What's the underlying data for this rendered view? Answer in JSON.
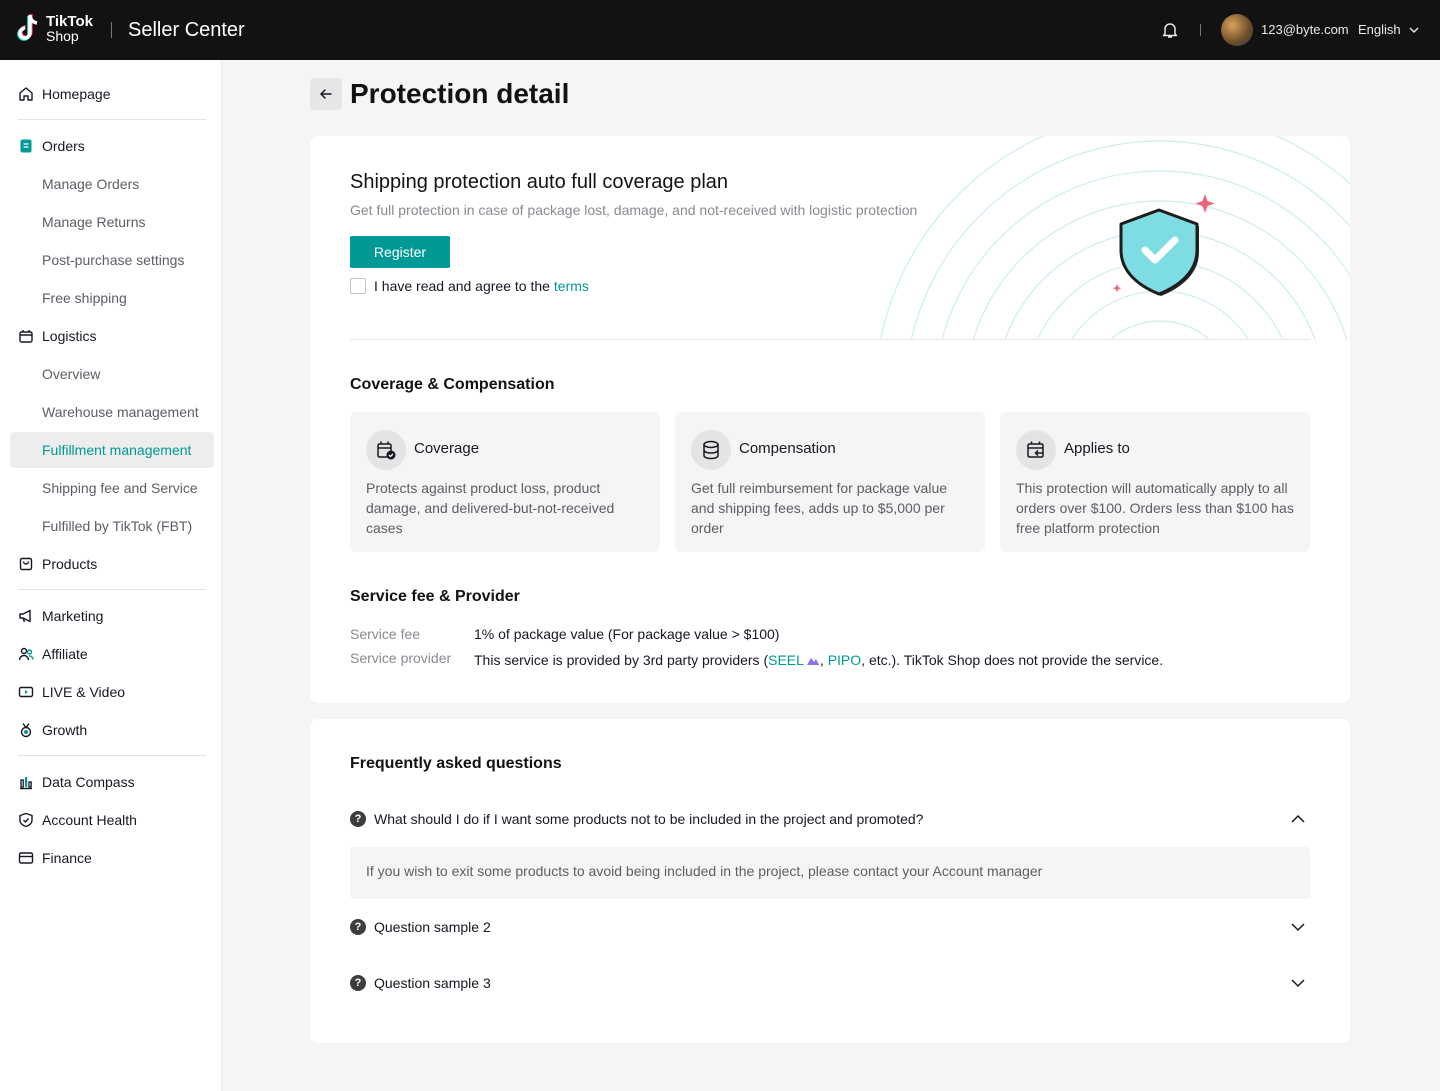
{
  "header": {
    "logo_line1": "TikTok",
    "logo_line2": "Shop",
    "app_name": "Seller Center",
    "user_email": "123@byte.com",
    "language": "English"
  },
  "sidebar": {
    "homepage": "Homepage",
    "orders": "Orders",
    "manage_orders": "Manage Orders",
    "manage_returns": "Manage Returns",
    "post_purchase": "Post-purchase settings",
    "free_shipping": "Free shipping",
    "logistics": "Logistics",
    "overview": "Overview",
    "warehouse": "Warehouse management",
    "fulfillment": "Fulfillment management",
    "shipping_fee": "Shipping fee and Service",
    "fbt": "Fulfilled by TikTok (FBT)",
    "products": "Products",
    "marketing": "Marketing",
    "affiliate": "Affiliate",
    "live_video": "LIVE & Video",
    "growth": "Growth",
    "data_compass": "Data Compass",
    "account_health": "Account Health",
    "finance": "Finance"
  },
  "page": {
    "title": "Protection detail"
  },
  "plan": {
    "title": "Shipping protection auto full coverage plan",
    "subtitle": "Get full protection in case of package lost, damage, and not-received with logistic protection",
    "register_label": "Register",
    "agree_text": "I have read and agree to the",
    "terms_label": "terms"
  },
  "coverage": {
    "section_title": "Coverage & Compensation",
    "features": [
      {
        "title": "Coverage",
        "desc": "Protects against product loss, product damage, and delivered-but-not-received cases",
        "icon": "package-shield-icon"
      },
      {
        "title": "Compensation",
        "desc": "Get full reimbursement for package value and shipping fees, adds up to $5,000 per order",
        "icon": "coins-icon"
      },
      {
        "title": "Applies to",
        "desc": "This protection will automatically apply to all orders over $100. Orders less than $100 has free platform protection",
        "icon": "package-return-icon"
      }
    ]
  },
  "service": {
    "section_title": "Service fee & Provider",
    "fee_label": "Service fee",
    "fee_value": "1% of package value (For package value > $100)",
    "provider_label": "Service provider",
    "provider_prefix": "This service is provided by 3rd party providers (",
    "provider_seel": "SEEL",
    "provider_comma": ", ",
    "provider_pipo": "PIPO",
    "provider_suffix": ", etc.). TikTok Shop does not provide the service."
  },
  "faq": {
    "title": "Frequently asked questions",
    "items": [
      {
        "question": "What should I do if I want some products not to be included in the project and promoted?",
        "answer": "If you wish to exit some products to avoid being included in the project, please contact your Account manager",
        "expanded": true
      },
      {
        "question": "Question sample 2",
        "expanded": false
      },
      {
        "question": "Question sample 3",
        "expanded": false
      }
    ]
  },
  "colors": {
    "accent": "#009995",
    "topbar": "#121212",
    "shield": "#7ddde3",
    "sparkle": "#f0627a"
  }
}
